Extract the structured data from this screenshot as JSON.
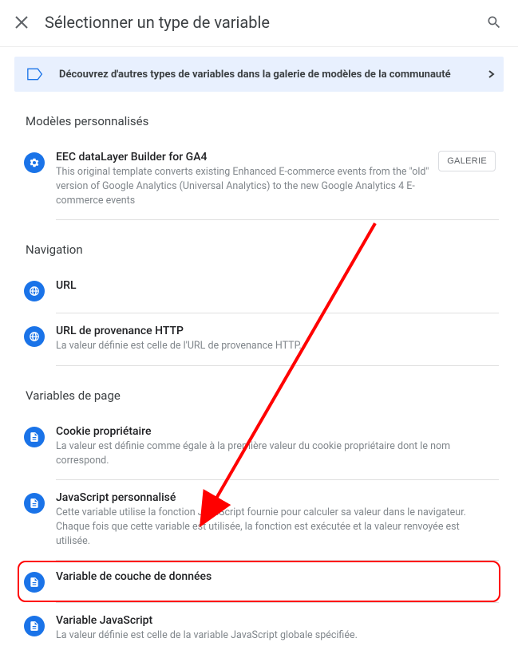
{
  "header": {
    "title": "Sélectionner un type de variable"
  },
  "banner": {
    "text": "Découvrez d'autres types de variables dans la galerie de modèles de la communauté"
  },
  "sections": {
    "custom": {
      "title": "Modèles personnalisés",
      "item": {
        "title": "EEC dataLayer Builder for GA4",
        "desc": "This original template converts existing Enhanced E-commerce events from the \"old\" version of Google Analytics (Universal Analytics) to the new Google Analytics 4 E-commerce events",
        "button": "GALERIE"
      }
    },
    "nav": {
      "title": "Navigation",
      "url": {
        "title": "URL"
      },
      "referrer": {
        "title": "URL de provenance HTTP",
        "desc": "La valeur définie est celle de l'URL de provenance HTTP."
      }
    },
    "page": {
      "title": "Variables de page",
      "cookie": {
        "title": "Cookie propriétaire",
        "desc": "La valeur est définie comme égale à la première valeur du cookie propriétaire dont le nom correspond."
      },
      "js": {
        "title": "JavaScript personnalisé",
        "desc": "Cette variable utilise la fonction JavaScript fournie pour calculer sa valeur dans le navigateur. Chaque fois que cette variable est utilisée, la fonction est exécutée et la valeur renvoyée est utilisée."
      },
      "dl": {
        "title": "Variable de couche de données"
      },
      "jsvar": {
        "title": "Variable JavaScript",
        "desc": "La valeur définie est celle de la variable JavaScript globale spécifiée."
      }
    }
  }
}
